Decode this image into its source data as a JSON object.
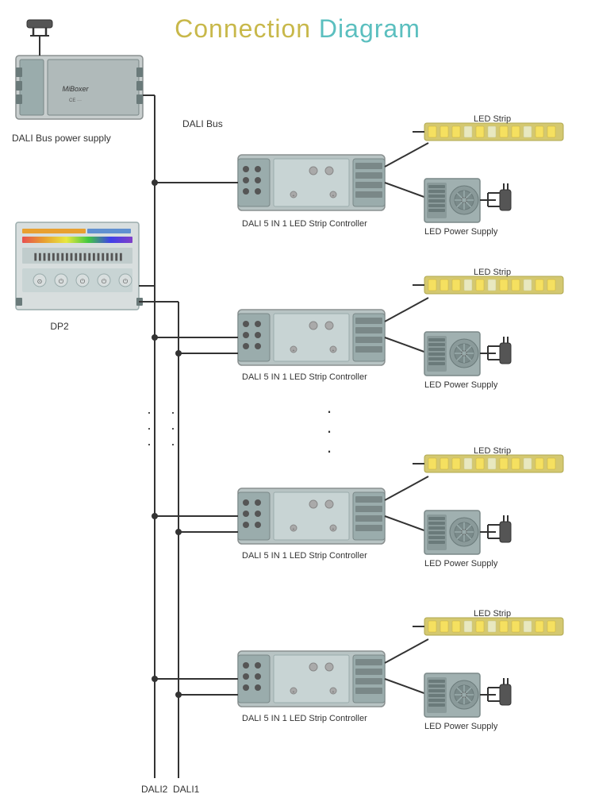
{
  "title": {
    "part1": "Connection",
    "part2": "Diagram"
  },
  "labels": {
    "dali_bus_power_supply": "DALI Bus power supply",
    "dali_bus": "DALI Bus",
    "dp2": "DP2",
    "dali_controller": "DALI 5 IN 1 LED Strip Controller",
    "led_strip": "LED Strip",
    "led_power_supply": "LED Power Supply",
    "dali2": "DALI2",
    "dali1": "DALI1",
    "ellipsis": "···",
    "dot": "·"
  },
  "colors": {
    "title_yellow": "#c8b84a",
    "title_teal": "#5bbfbf",
    "device_gray": "#8a9090",
    "device_light": "#b0baba",
    "wire": "#333",
    "led_warm": "#f5d060",
    "led_cool": "#e8e8c0"
  }
}
